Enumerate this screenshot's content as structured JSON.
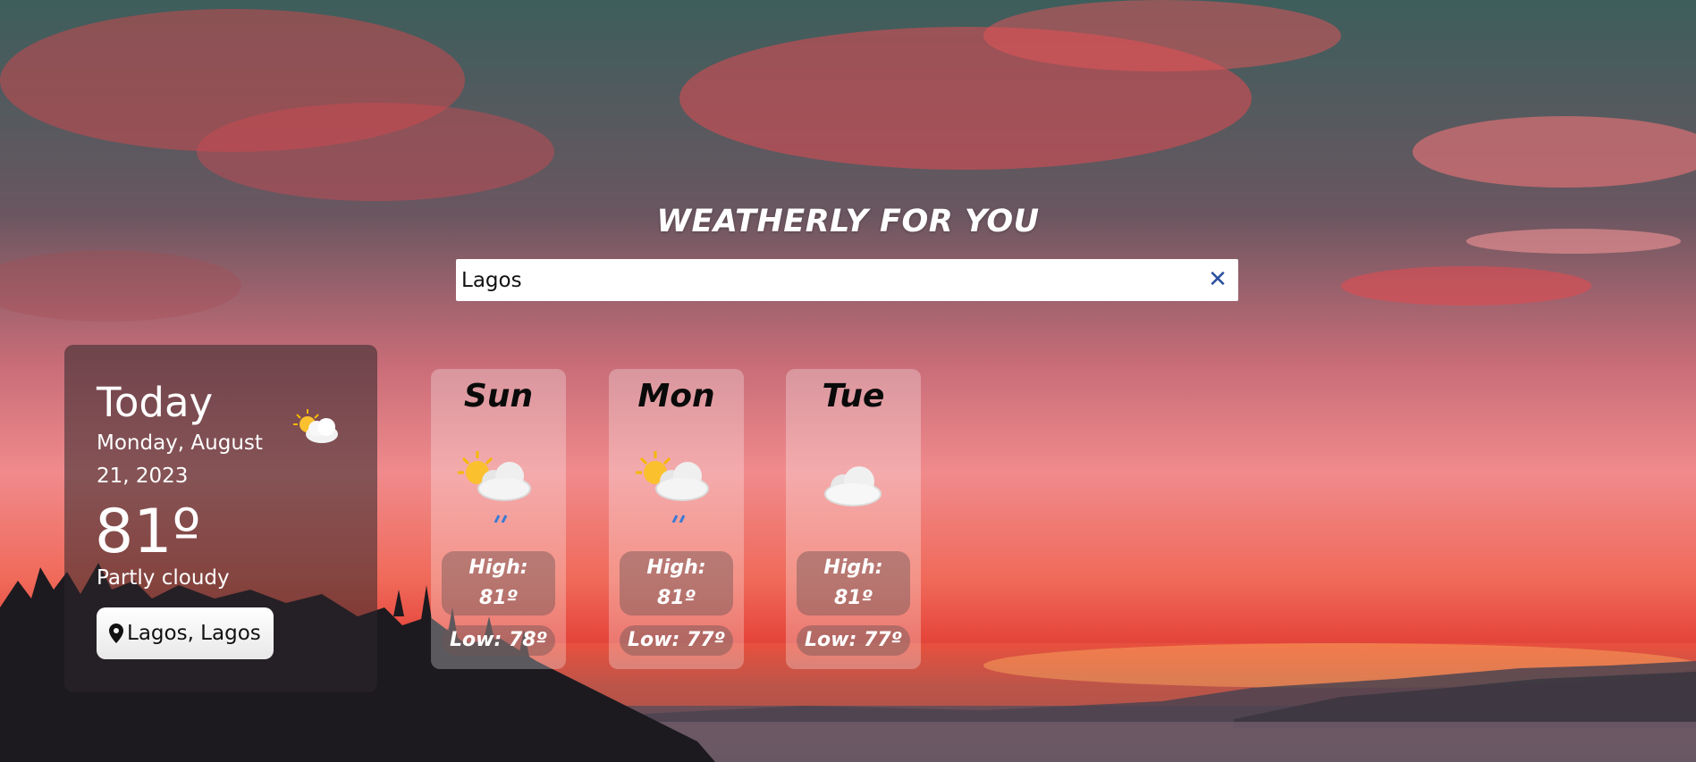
{
  "header": {
    "title": "WEATHERLY FOR YOU"
  },
  "search": {
    "value": "Lagos",
    "clear_icon": "close-icon"
  },
  "today": {
    "label": "Today",
    "date": "Monday, August 21, 2023",
    "temperature": "81º",
    "condition": "Partly cloudy",
    "location": "Lagos, Lagos",
    "icon": "partly-cloudy-icon",
    "location_icon": "map-pin-icon"
  },
  "forecast": [
    {
      "day": "Sun",
      "high": "High: 81º",
      "low": "Low: 78º",
      "icon": "partly-cloudy-rain-icon"
    },
    {
      "day": "Mon",
      "high": "High: 81º",
      "low": "Low: 77º",
      "icon": "partly-cloudy-rain-icon"
    },
    {
      "day": "Tue",
      "high": "High: 81º",
      "low": "Low: 77º",
      "icon": "cloud-icon"
    }
  ],
  "colors": {
    "clear_icon": "#2c4f9e",
    "text_light": "#ffffff",
    "text_dark": "#0a0a0a"
  }
}
